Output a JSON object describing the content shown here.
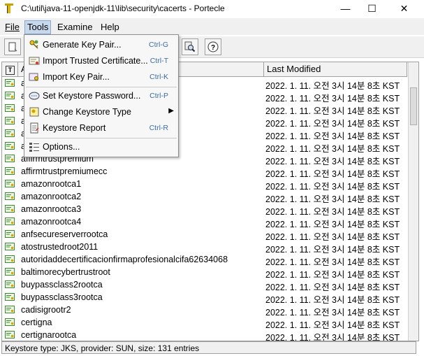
{
  "window": {
    "title": "C:\\util\\java-11-openjdk-11\\lib\\security\\cacerts - Portecle",
    "minimize": "—",
    "maximize": "☐",
    "close": "✕"
  },
  "menubar": [
    "File",
    "Tools",
    "Examine",
    "Help"
  ],
  "tools_menu": {
    "items": [
      {
        "label": "Generate Key Pair...",
        "shortcut": "Ctrl-G",
        "icon": "key-pair-icon"
      },
      {
        "label": "Import Trusted Certificate...",
        "shortcut": "Ctrl-T",
        "icon": "certificate-import-icon"
      },
      {
        "label": "Import Key Pair...",
        "shortcut": "Ctrl-K",
        "icon": "key-import-icon"
      },
      {
        "label": "Set Keystore Password...",
        "shortcut": "Ctrl-P",
        "icon": "password-icon"
      },
      {
        "label": "Change Keystore Type",
        "shortcut": "",
        "icon": "keystore-type-icon",
        "submenu": true
      },
      {
        "label": "Keystore Report",
        "shortcut": "Ctrl-R",
        "icon": "report-icon"
      },
      {
        "label": "Options...",
        "shortcut": "",
        "icon": "options-icon"
      }
    ]
  },
  "table": {
    "header_icon": "T",
    "col_alias": "A",
    "col_modified": "Last Modified",
    "rows": [
      {
        "alias": "a",
        "date": "2022. 1. 11. 오전 3시 14분 8초 KST"
      },
      {
        "alias": "a",
        "date": "2022. 1. 11. 오전 3시 14분 8초 KST"
      },
      {
        "alias": "a",
        "date": "2022. 1. 11. 오전 3시 14분 8초 KST"
      },
      {
        "alias": "a",
        "date": "2022. 1. 11. 오전 3시 14분 8초 KST"
      },
      {
        "alias": "a",
        "date": "2022. 1. 11. 오전 3시 14분 8초 KST"
      },
      {
        "alias": "a",
        "date": "2022. 1. 11. 오전 3시 14분 8초 KST"
      },
      {
        "alias": "affirmtrustpremium",
        "date": "2022. 1. 11. 오전 3시 14분 8초 KST"
      },
      {
        "alias": "affirmtrustpremiumecc",
        "date": "2022. 1. 11. 오전 3시 14분 8초 KST"
      },
      {
        "alias": "amazonrootca1",
        "date": "2022. 1. 11. 오전 3시 14분 8초 KST"
      },
      {
        "alias": "amazonrootca2",
        "date": "2022. 1. 11. 오전 3시 14분 8초 KST"
      },
      {
        "alias": "amazonrootca3",
        "date": "2022. 1. 11. 오전 3시 14분 8초 KST"
      },
      {
        "alias": "amazonrootca4",
        "date": "2022. 1. 11. 오전 3시 14분 8초 KST"
      },
      {
        "alias": "anfsecureserverrootca",
        "date": "2022. 1. 11. 오전 3시 14분 8초 KST"
      },
      {
        "alias": "atostrustedroot2011",
        "date": "2022. 1. 11. 오전 3시 14분 8초 KST"
      },
      {
        "alias": "autoridaddecertificacionfirmaprofesionalcifa62634068",
        "date": "2022. 1. 11. 오전 3시 14분 8초 KST"
      },
      {
        "alias": "baltimorecybertrustroot",
        "date": "2022. 1. 11. 오전 3시 14분 8초 KST"
      },
      {
        "alias": "buypassclass2rootca",
        "date": "2022. 1. 11. 오전 3시 14분 8초 KST"
      },
      {
        "alias": "buypassclass3rootca",
        "date": "2022. 1. 11. 오전 3시 14분 8초 KST"
      },
      {
        "alias": "cadisigrootr2",
        "date": "2022. 1. 11. 오전 3시 14분 8초 KST"
      },
      {
        "alias": "certigna",
        "date": "2022. 1. 11. 오전 3시 14분 8초 KST"
      },
      {
        "alias": "certignarootca",
        "date": "2022. 1. 11. 오전 3시 14분 8초 KST"
      }
    ]
  },
  "status": "Keystore type: JKS, provider: SUN, size: 131 entries",
  "colors": {
    "cert_icon": "#3c8a2e",
    "menu_highlight": "#c7d7ec",
    "shortcut": "#3a6ea5"
  }
}
